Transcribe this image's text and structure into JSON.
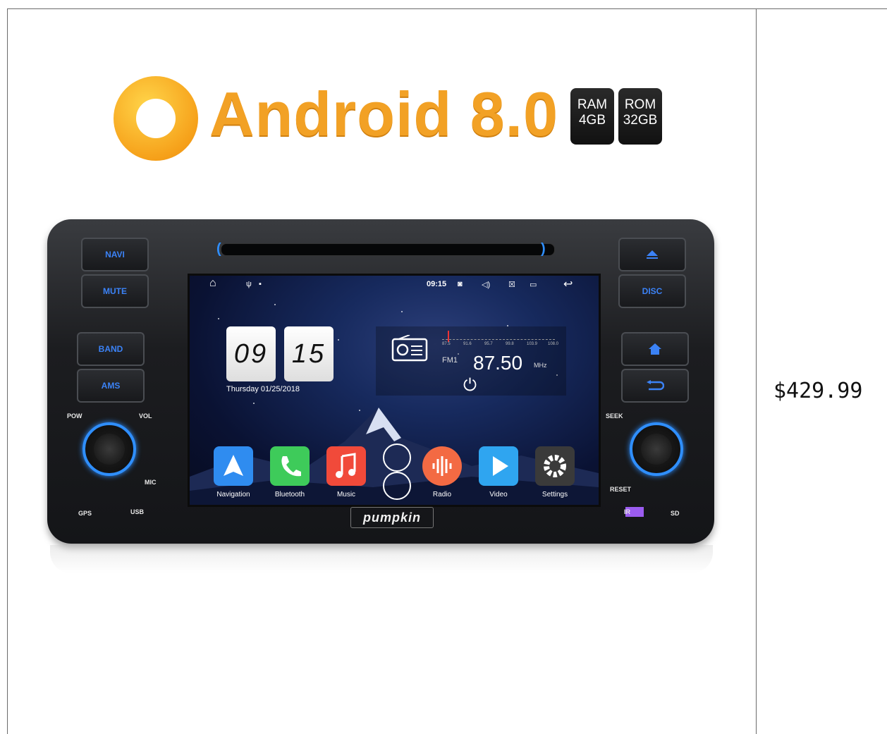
{
  "product": {
    "banner_title": "Android 8.0",
    "ram": {
      "label": "RAM",
      "size": "4GB"
    },
    "rom": {
      "label": "ROM",
      "size": "32GB"
    },
    "brand": "pumpkin"
  },
  "price": "$429.99",
  "head_unit": {
    "buttons": {
      "navi": "NAVI",
      "mute": "MUTE",
      "band": "BAND",
      "ams": "AMS",
      "disc": "DISC"
    },
    "labels": {
      "pow": "POW",
      "vol": "VOL",
      "seek": "SEEK",
      "mic": "MIC",
      "reset": "RESET",
      "gps": "GPS",
      "usb": "USB",
      "ir": "IR",
      "sd": "SD"
    }
  },
  "screen": {
    "status_time": "09:15",
    "clock_hour": "09",
    "clock_minute": "15",
    "date": "Thursday 01/25/2018",
    "radio": {
      "band": "FM1",
      "frequency": "87.50",
      "unit": "MHz",
      "scale": [
        "87.5",
        "91.6",
        "95.7",
        "99.8",
        "103.9",
        "108.0"
      ]
    },
    "apps": [
      {
        "label": "Navigation",
        "color": "#2f8cf0"
      },
      {
        "label": "Bluetooth",
        "color": "#3ecb5a"
      },
      {
        "label": "Music",
        "color": "#f14a3a"
      },
      {
        "label": "Radio",
        "color": "#f36a43"
      },
      {
        "label": "Video",
        "color": "#2fa5f0"
      },
      {
        "label": "Settings",
        "color": "#3a3a3a"
      }
    ]
  },
  "colors": {
    "accent_blue": "#2f8fff",
    "android_orange": "#f2a125"
  }
}
